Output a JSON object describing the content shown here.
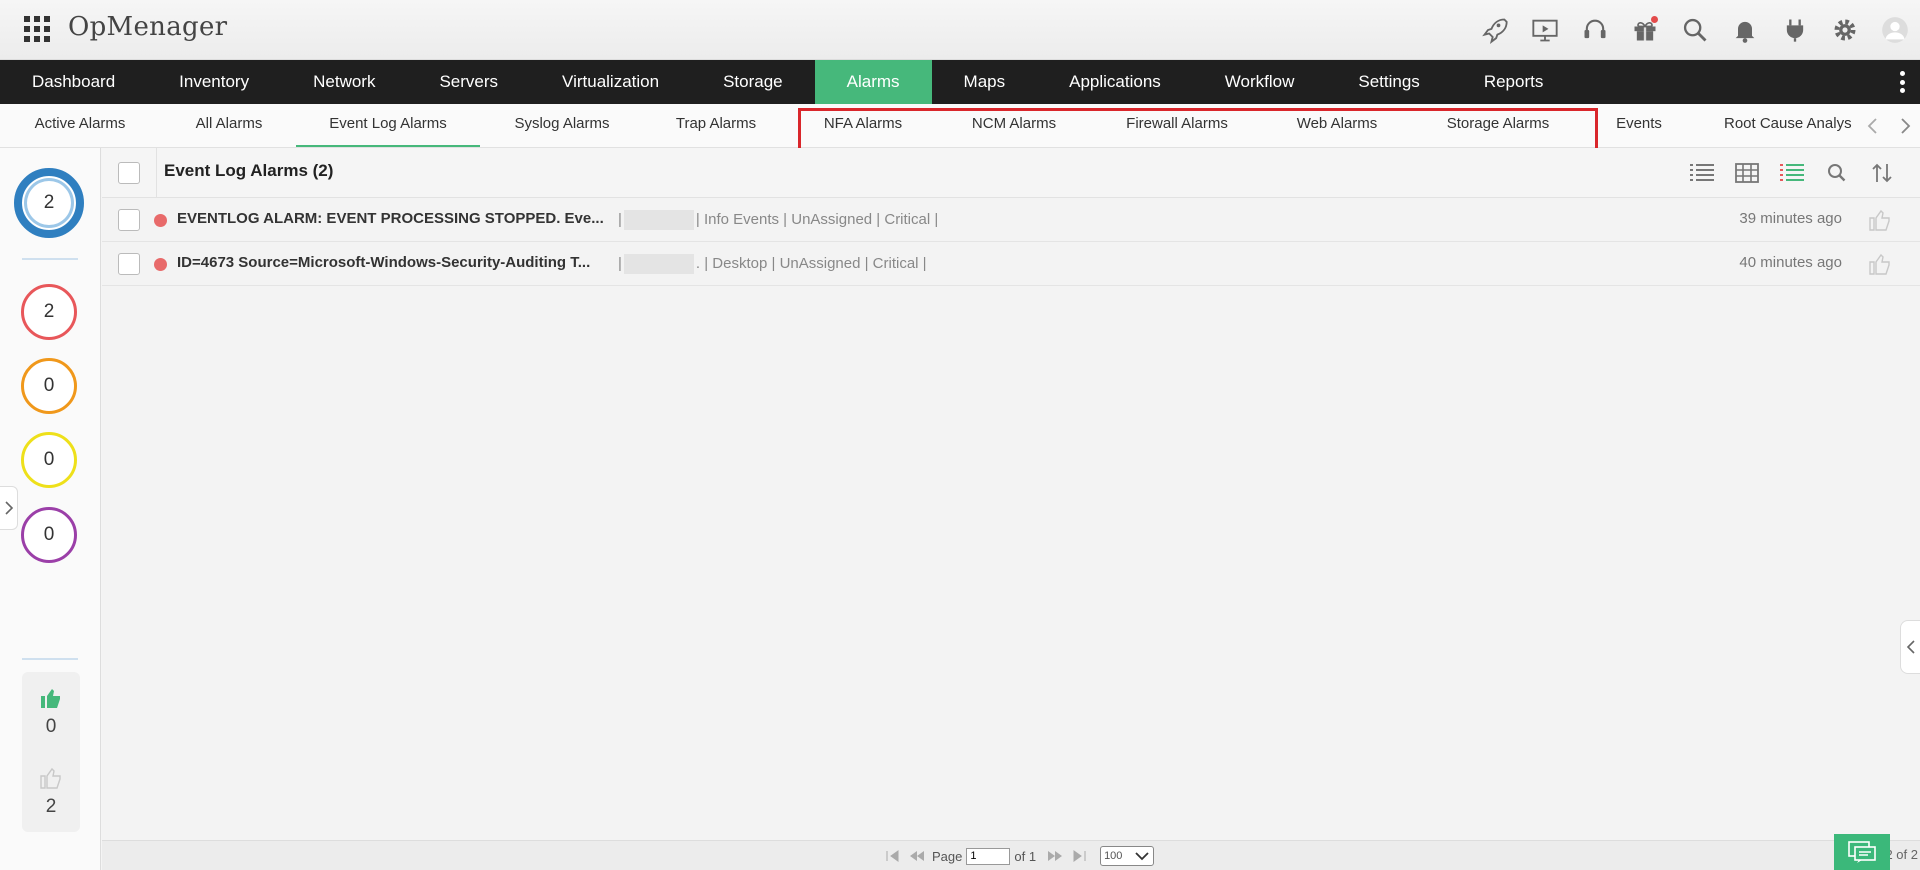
{
  "app": {
    "title": "OpMenager"
  },
  "header_tools": [
    "rocket-icon",
    "presentation-icon",
    "headset-icon",
    "gift-icon",
    "search-icon",
    "bell-icon",
    "plug-icon",
    "gear-icon",
    "user-avatar-icon"
  ],
  "main_nav": {
    "items": [
      {
        "label": "Dashboard"
      },
      {
        "label": "Inventory"
      },
      {
        "label": "Network"
      },
      {
        "label": "Servers"
      },
      {
        "label": "Virtualization"
      },
      {
        "label": "Storage"
      },
      {
        "label": "Alarms",
        "active": true
      },
      {
        "label": "Maps"
      },
      {
        "label": "Applications"
      },
      {
        "label": "Workflow"
      },
      {
        "label": "Settings"
      },
      {
        "label": "Reports"
      }
    ]
  },
  "sub_nav": {
    "tabs": [
      {
        "label": "Active Alarms"
      },
      {
        "label": "All Alarms"
      },
      {
        "label": "Event Log Alarms",
        "active": true
      },
      {
        "label": "Syslog Alarms"
      },
      {
        "label": "Trap Alarms"
      },
      {
        "label": "NFA Alarms"
      },
      {
        "label": "NCM Alarms"
      },
      {
        "label": "Firewall Alarms"
      },
      {
        "label": "Web Alarms"
      },
      {
        "label": "Storage Alarms"
      },
      {
        "label": "Events"
      },
      {
        "label": "Root Cause Analys"
      }
    ]
  },
  "severity_summary": {
    "total": "2",
    "critical": "2",
    "trouble": "0",
    "attention": "0",
    "service_down": "0",
    "colors": {
      "total": "#2f7fc0",
      "critical": "#e8575a",
      "trouble": "#f0981b",
      "attention": "#eee01a",
      "service_down": "#9b3fa8"
    }
  },
  "votes": {
    "liked": "0",
    "disliked": "2"
  },
  "content": {
    "title": "Event Log Alarms (2)",
    "rows": [
      {
        "message": "EVENTLOG ALARM: EVENT PROCESSING STOPPED. Eve...",
        "meta_prefix": "|",
        "meta_suffix": "| Info Events | UnAssigned | Critical |",
        "time": "39 minutes ago",
        "severity_color": "#e86a6a"
      },
      {
        "message": "ID=4673 Source=Microsoft-Windows-Security-Auditing T...",
        "meta_prefix": "|",
        "meta_suffix": ". | Desktop | UnAssigned | Critical |",
        "time": "40 minutes ago",
        "severity_color": "#e86a6a"
      }
    ]
  },
  "pagination": {
    "page_label": "Page",
    "page_value": "1",
    "of_label": "of 1",
    "per_page": "100",
    "view_count": "View 1 - 2 of 2"
  },
  "accent_color": "#46b87b",
  "highlight_color": "#d9262b"
}
